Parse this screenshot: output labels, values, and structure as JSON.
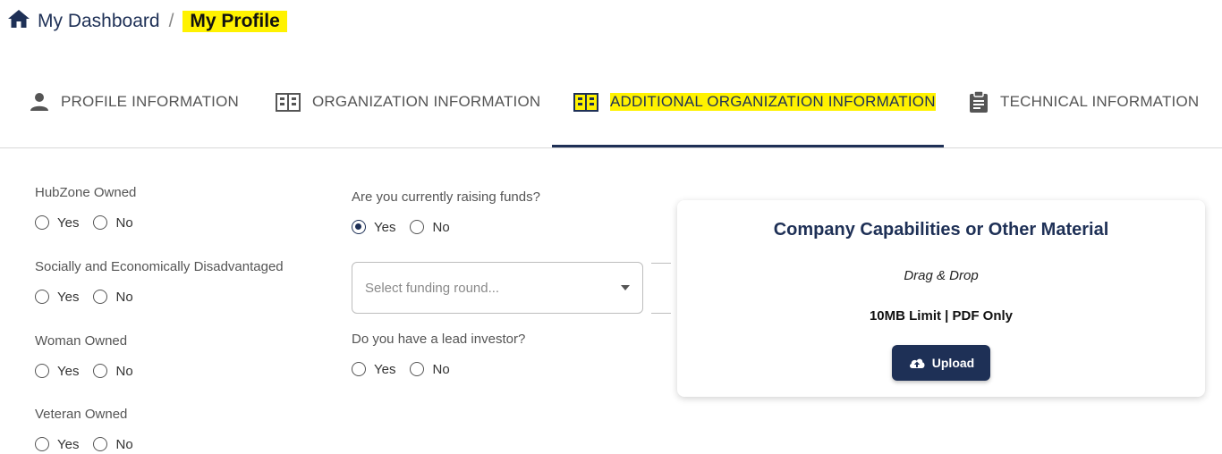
{
  "breadcrumb": {
    "home": "My Dashboard",
    "separator": "/",
    "current": "My Profile"
  },
  "tabs": [
    {
      "label": "PROFILE INFORMATION",
      "icon": "person-icon",
      "active": false
    },
    {
      "label": "ORGANIZATION INFORMATION",
      "icon": "building-icon",
      "active": false
    },
    {
      "label": "ADDITIONAL ORGANIZATION INFORMATION",
      "icon": "building-icon",
      "active": true
    },
    {
      "label": "TECHNICAL INFORMATION",
      "icon": "clipboard-icon",
      "active": false
    }
  ],
  "left_fields": [
    {
      "label": "HubZone Owned",
      "yes": "Yes",
      "no": "No",
      "selected": null
    },
    {
      "label": "Socially and Economically Disadvantaged",
      "yes": "Yes",
      "no": "No",
      "selected": null
    },
    {
      "label": "Woman Owned",
      "yes": "Yes",
      "no": "No",
      "selected": null
    },
    {
      "label": "Veteran Owned",
      "yes": "Yes",
      "no": "No",
      "selected": null
    }
  ],
  "funds": {
    "label": "Are you currently raising funds?",
    "yes": "Yes",
    "no": "No",
    "selected": "Yes"
  },
  "funding_round": {
    "placeholder": "Select funding round..."
  },
  "lead_investor": {
    "label": "Do you have a lead investor?",
    "yes": "Yes",
    "no": "No",
    "selected": null
  },
  "upload_card": {
    "title": "Company Capabilities or Other Material",
    "drag_text": "Drag & Drop",
    "limit_text": "10MB Limit | PDF Only",
    "button_label": "Upload",
    "button_icon": "cloud-upload-icon"
  },
  "colors": {
    "brand": "#1e3056",
    "highlight": "#fff200"
  }
}
